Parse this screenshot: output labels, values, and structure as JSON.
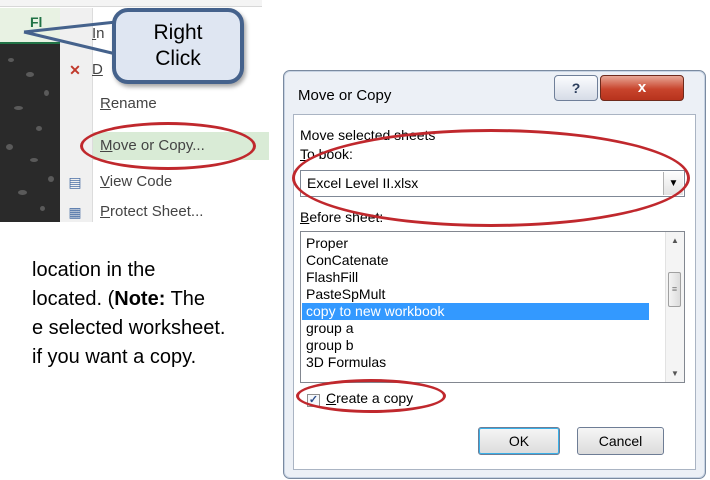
{
  "context_menu": {
    "sheet_tab_partial": "Fl",
    "items": [
      {
        "label_before": "",
        "accel": "I",
        "label_after": "n",
        "icon": ""
      },
      {
        "label_before": "",
        "accel": "D",
        "label_after": "",
        "icon": "delete-sheet-icon"
      },
      {
        "label_before": "",
        "accel": "R",
        "label_after": "ename",
        "icon": ""
      },
      {
        "label_before": "",
        "accel": "M",
        "label_after": "ove or Copy...",
        "icon": ""
      },
      {
        "label_before": "",
        "accel": "V",
        "label_after": "iew Code",
        "icon": "view-code-icon"
      },
      {
        "label_before": "",
        "accel": "P",
        "label_after": "rotect Sheet...",
        "icon": "protect-sheet-icon"
      }
    ]
  },
  "callout": {
    "line1": "Right",
    "line2": "Click"
  },
  "instructions": {
    "line1": " location in the",
    "line2_before": "located. (",
    "line2_bold": "Note:",
    "line2_after": "  The",
    "line3": "e selected worksheet.",
    "line4": "if you want a copy."
  },
  "dialog": {
    "title": "Move or Copy",
    "help_label": "?",
    "close_label": "x",
    "move_label": "Move selected sheets",
    "to_book_accel": "T",
    "to_book_rest": "o book:",
    "to_book_value": "Excel Level II.xlsx",
    "before_sheet_accel": "B",
    "before_sheet_rest": "efore sheet:",
    "sheets": [
      "Proper",
      "ConCatenate",
      "FlashFill",
      "PasteSpMult",
      "copy to new workbook",
      "group a",
      "group b",
      "3D Formulas"
    ],
    "selected_sheet_index": 4,
    "create_copy_accel": "C",
    "create_copy_rest": "reate a copy",
    "create_copy_checked": true,
    "check_mark": "✓",
    "ok_label": "OK",
    "cancel_label": "Cancel"
  },
  "colors": {
    "highlight_oval": "#c0282d",
    "selection": "#3399ff",
    "callout_border": "#45628c"
  }
}
